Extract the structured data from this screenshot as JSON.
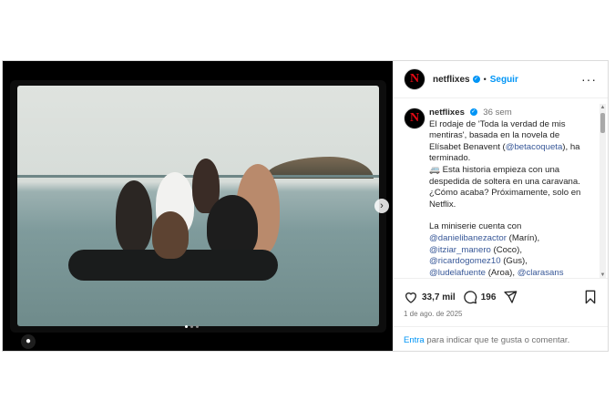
{
  "post": {
    "username": "netflixes",
    "follow_label": "Seguir",
    "separator": "•",
    "more_label": "···",
    "time_ago": "36 sem",
    "caption_lines": [
      "El rodaje de 'Toda la verdad de mis mentiras', basada en la novela de Elísabet Benavent (",
      "@betacoqueta",
      "), ha terminado.",
      "🚐 Esta historia empieza con una despedida de soltera en una caravana. ¿Cómo acaba? Próximamente, solo en Netflix."
    ],
    "caption_p2_intro": "La miniserie cuenta con",
    "cast": [
      {
        "handle": "@danielibanezactor",
        "role": "(Marín),"
      },
      {
        "handle": "@itziar_manero",
        "role": "(Coco),"
      },
      {
        "handle": "@ricardogomez10",
        "role": "(Gus),"
      },
      {
        "handle": "@ludelafuente",
        "role": "(Aroa),",
        "extra": "@clarasans"
      }
    ],
    "likes": "33,7 mil",
    "comments": "196",
    "date": "1 de ago. de 2025",
    "comment_login_link": "Entra",
    "comment_login_text": "para indicar que te gusta o comentar.",
    "media_nav_label": "›",
    "avatar_letter": "N"
  },
  "colors": {
    "accent": "#0095f6",
    "netflix_red": "#e50914"
  },
  "icons": [
    "heart-icon",
    "comment-icon",
    "share-icon",
    "bookmark-icon",
    "verified-icon",
    "user-tag-icon",
    "chevron-right-icon"
  ]
}
